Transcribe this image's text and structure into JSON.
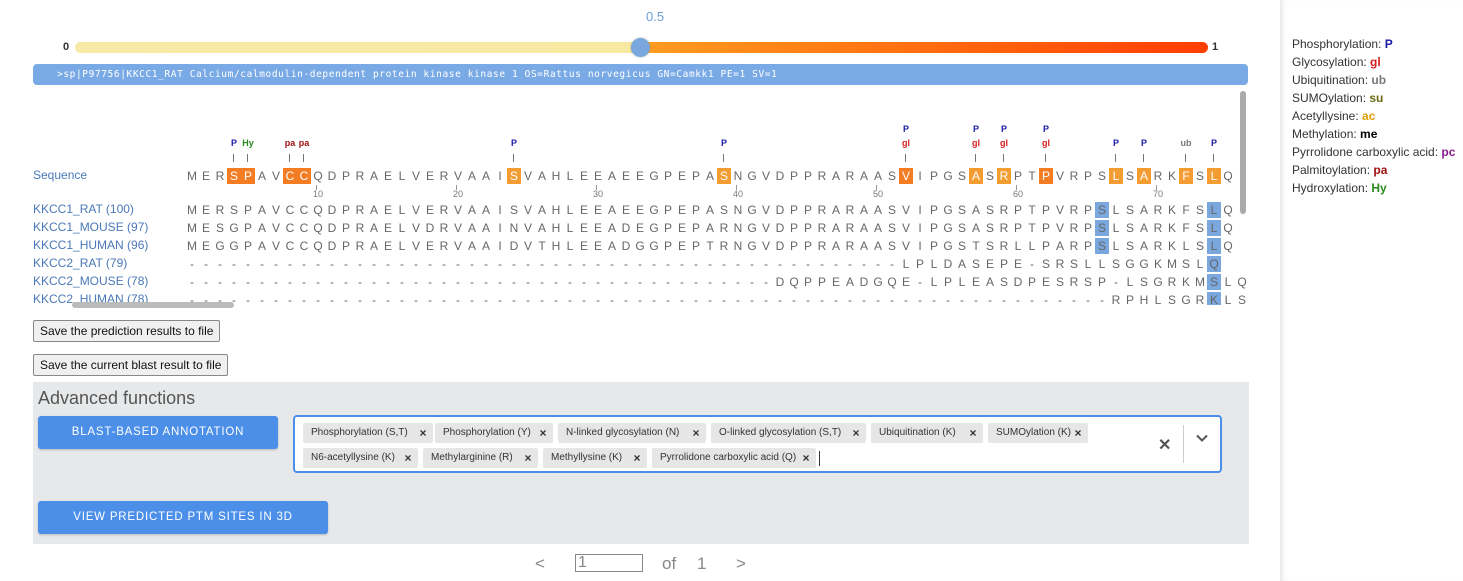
{
  "slider": {
    "value": "0.5",
    "min": "0",
    "max": "1",
    "value_fraction": 0.5
  },
  "header": "  >sp|P97756|KKCC1_RAT Calcium/calmodulin-dependent protein kinase kinase 1 OS=Rattus norvegicus GN=Camkk1 PE=1 SV=1",
  "alignment": {
    "rows": [
      {
        "label": "Sequence",
        "seq": "MERSPAVCCQDPRAELVERVAAISVAHLEEAEEGPEPASNGVDPPRARAASVIPGSASRPTPVRPSLSARKFSLQ"
      },
      {
        "label": "KKCC1_RAT (100)",
        "seq": "MERSPAVCCQDPRAELVERVAAISVAHLEEAEEGPEPASNGVDPPRARAASVIPGSASRPTPVRPSLSARKFSLQ"
      },
      {
        "label": "KKCC1_MOUSE (97)",
        "seq": "MESGPAVCCQDPRAELVDRVAAINVAHLEEADEGPEPARNGVDPPRARAASVIPGSASRPTPVRPSLSARKFSLQ"
      },
      {
        "label": "KKCC1_HUMAN (96)",
        "seq": "MEGGPAVCCQDPRAELVERVAAIDVTHLEEADGGPEPTRNGVDPPRARAASVIPGSTSRLLPARPSLSARKLSLQ"
      },
      {
        "label": "KKCC2_RAT (79)",
        "seq": "---------------------------------------------------LPLDASEPE-SRSLLSGGKMSLQ"
      },
      {
        "label": "KKCC2_MOUSE (78)",
        "seq": "------------------------------------------DQPPEADGQE-LPLEASDPESRSP-LSGRKMSLQ"
      },
      {
        "label": "KKCC2_HUMAN (78)",
        "seq": "------------------------------------------------------------------RPHLSGRKLSLQ"
      }
    ],
    "ruler": [
      "10",
      "20",
      "30",
      "40",
      "50",
      "60",
      "70"
    ],
    "ptm_marks": [
      {
        "pos": 3,
        "top": "P"
      },
      {
        "pos": 4,
        "top": "Hy"
      },
      {
        "pos": 7,
        "top": "pa"
      },
      {
        "pos": 8,
        "top": "pa"
      },
      {
        "pos": 23,
        "top": "P"
      },
      {
        "pos": 38,
        "top": "P"
      },
      {
        "pos": 51,
        "top": "P",
        "bottom": "gl"
      },
      {
        "pos": 56,
        "top": "P",
        "bottom": "gl"
      },
      {
        "pos": 58,
        "top": "P",
        "bottom": "gl"
      },
      {
        "pos": 61,
        "top": "P",
        "bottom": "gl"
      },
      {
        "pos": 66,
        "top": "P"
      },
      {
        "pos": 68,
        "top": "P"
      },
      {
        "pos": 71,
        "top": "ub"
      },
      {
        "pos": 73,
        "top": "P"
      }
    ]
  },
  "buttons": {
    "save_prediction": "Save the prediction results to file",
    "save_blast": "Save the current blast result to file"
  },
  "advanced": {
    "title": "Advanced functions",
    "blast_button": "BLAST-BASED ANNOTATION",
    "view3d_button": "VIEW PREDICTED PTM SITES IN 3D STRUCTURE",
    "chips": [
      "Phosphorylation (S,T)",
      "Phosphorylation (Y)",
      "N-linked glycosylation (N)",
      "O-linked glycosylation (S,T)",
      "Ubiquitination (K)",
      "SUMOylation (K)",
      "N6-acetyllysine (K)",
      "Methylarginine (R)",
      "Methyllysine (K)",
      "Pyrrolidone carboxylic acid (Q)"
    ]
  },
  "pager": {
    "prev": "<",
    "next": ">",
    "current": "1",
    "of": "of",
    "total": "1"
  },
  "legend": [
    {
      "label": "Phosphorylation:",
      "code": "P",
      "color": "#1a1aa6"
    },
    {
      "label": "Glycosylation:",
      "code": "gl",
      "color": "#d41c1c"
    },
    {
      "label": "Ubiquitination:",
      "code": "ub",
      "color": "#777777"
    },
    {
      "label": "SUMOylation:",
      "code": "su",
      "color": "#6b6b12"
    },
    {
      "label": "Acetyllysine:",
      "code": "ac",
      "color": "#e0a000"
    },
    {
      "label": "Methylation:",
      "code": "me",
      "color": "#000000"
    },
    {
      "label": "Pyrrolidone carboxylic acid:",
      "code": "pc",
      "color": "#8a1c8a"
    },
    {
      "label": "Palmitoylation:",
      "code": "pa",
      "color": "#a01010"
    },
    {
      "label": "Hydroxylation:",
      "code": "Hy",
      "color": "#2a8a1e"
    }
  ]
}
